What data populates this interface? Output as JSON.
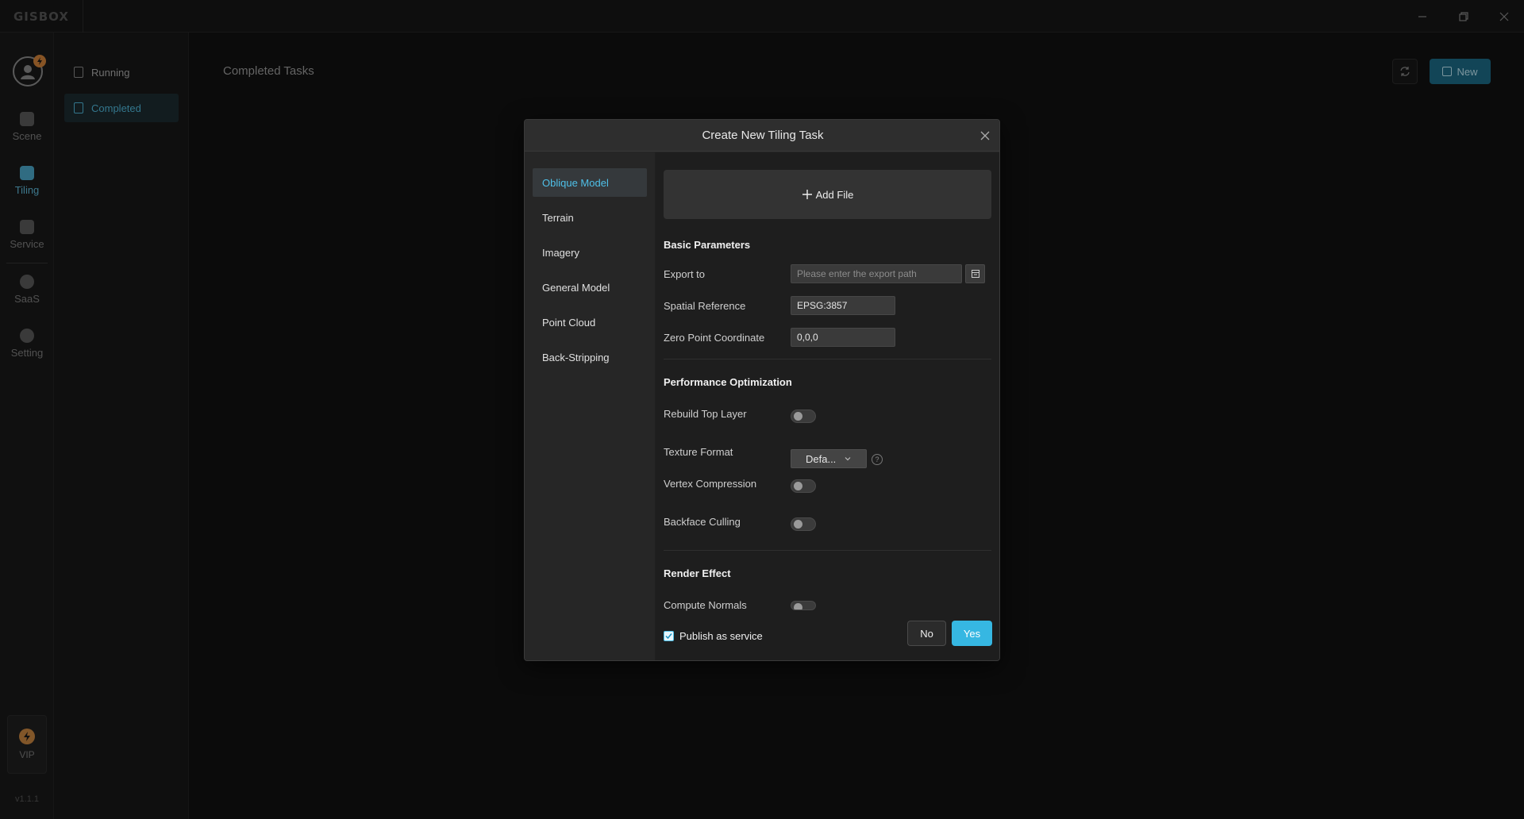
{
  "app": {
    "logo": "GISBOX",
    "window_controls": [
      "minimize",
      "restore",
      "close"
    ]
  },
  "rail": {
    "items": [
      {
        "label": "Scene",
        "icon": "home-icon"
      },
      {
        "label": "Tiling",
        "icon": "tiling-icon"
      },
      {
        "label": "Service",
        "icon": "service-icon"
      },
      {
        "label": "SaaS",
        "icon": "lock-icon"
      },
      {
        "label": "Setting",
        "icon": "gear-icon"
      }
    ],
    "active": "Tiling",
    "vip_label": "VIP",
    "version": "v1.1.1"
  },
  "subnav": {
    "items": [
      {
        "label": "Running"
      },
      {
        "label": "Completed"
      }
    ],
    "active": "Completed"
  },
  "main": {
    "title": "Completed Tasks",
    "new_button": "New"
  },
  "dialog": {
    "title": "Create New Tiling Task",
    "tabs": [
      {
        "label": "Oblique Model"
      },
      {
        "label": "Terrain"
      },
      {
        "label": "Imagery"
      },
      {
        "label": "General Model"
      },
      {
        "label": "Point Cloud"
      },
      {
        "label": "Back-Stripping"
      }
    ],
    "active_tab": "Oblique Model",
    "add_file": "Add File",
    "basic": {
      "title": "Basic Parameters",
      "export_label": "Export to",
      "export_placeholder": "Please enter the export path",
      "spatial_label": "Spatial Reference",
      "spatial_value": "EPSG:3857",
      "zero_label": "Zero Point Coordinate",
      "zero_value": "0,0,0"
    },
    "performance": {
      "title": "Performance Optimization",
      "rebuild_label": "Rebuild Top Layer",
      "rebuild_on": false,
      "texture_label": "Texture Format",
      "texture_value": "Defa...",
      "vertex_label": "Vertex Compression",
      "vertex_on": false,
      "backface_label": "Backface Culling",
      "backface_on": false
    },
    "render": {
      "title": "Render Effect",
      "normals_label": "Compute Normals",
      "normals_on": false
    },
    "publish_label": "Publish as service",
    "publish_checked": true,
    "no_label": "No",
    "yes_label": "Yes"
  },
  "colors": {
    "accent": "#36b7e2",
    "active_text": "#4fc0e8",
    "background": "#111111"
  }
}
